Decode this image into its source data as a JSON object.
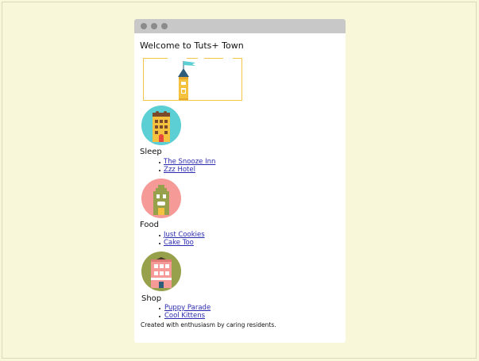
{
  "page": {
    "title": "Welcome to Tuts+ Town",
    "footer": "Created with enthusiasm by caring residents."
  },
  "sections": [
    {
      "title": "Sleep",
      "links": [
        "The Snooze Inn",
        "Zzz Hotel"
      ],
      "icon": "hotel-icon",
      "color": "#5bcfd4"
    },
    {
      "title": "Food",
      "links": [
        "Just Cookies",
        "Cake Too"
      ],
      "icon": "bakery-icon",
      "color": "#f59a96"
    },
    {
      "title": "Shop",
      "links": [
        "Puppy Parade",
        "Cool Kittens"
      ],
      "icon": "shop-icon",
      "color": "#97a04a"
    }
  ],
  "colors": {
    "page_bg": "#f8f7d9",
    "titlebar": "#c8c8c8",
    "link": "#2a2ab0",
    "hero_border": "#f3c64b"
  }
}
